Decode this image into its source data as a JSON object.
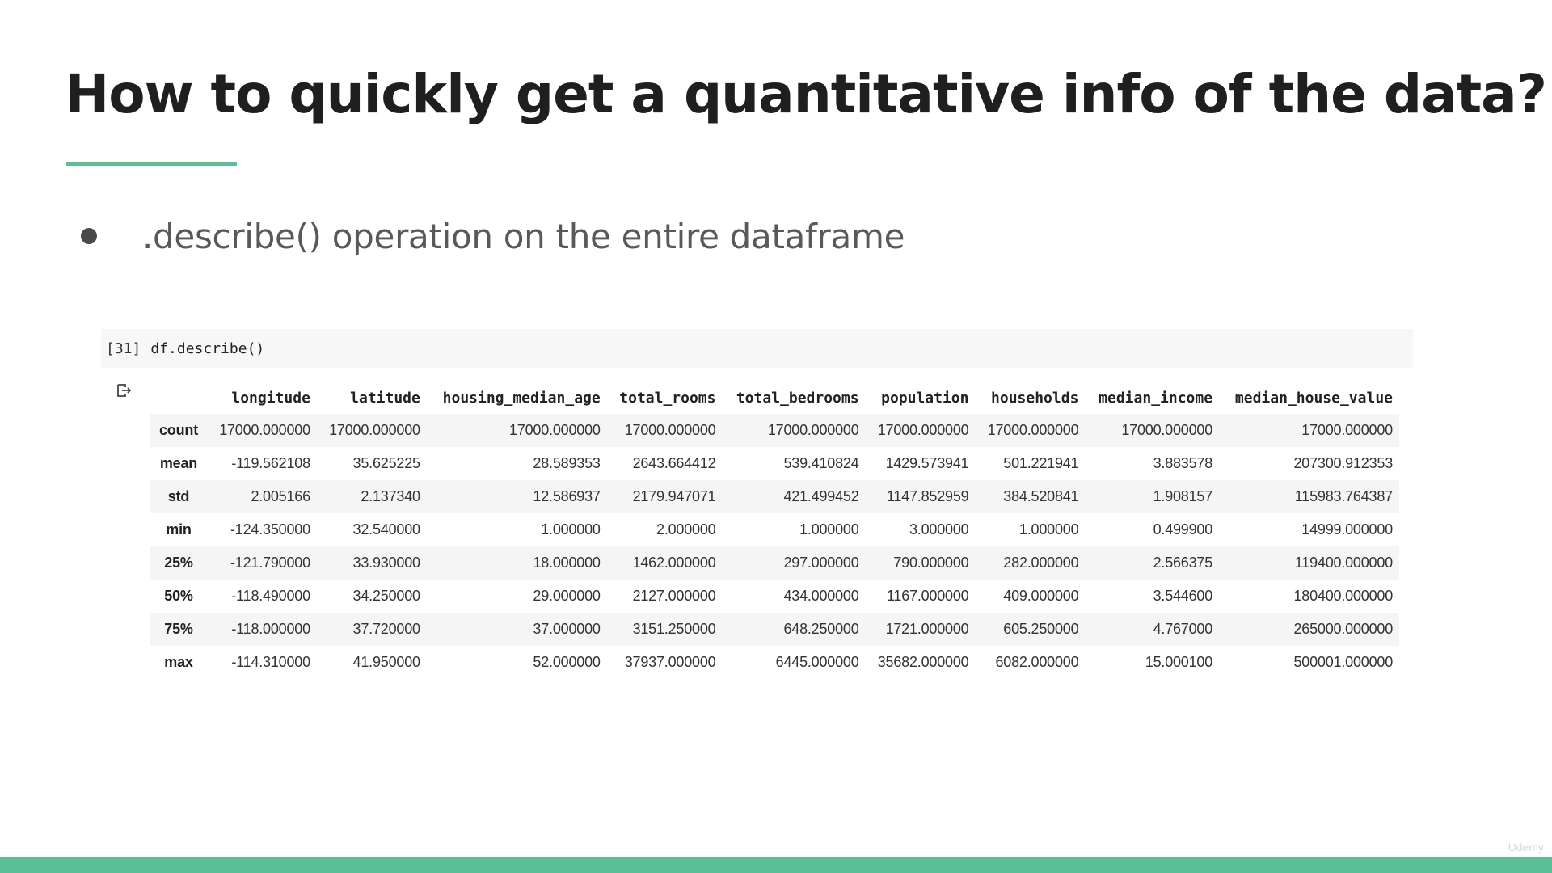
{
  "slide": {
    "title": "How to quickly get a quantitative info of the data?",
    "bullet": ".describe() operation on the entire dataframe",
    "accent_color": "#5bbf95"
  },
  "notebook": {
    "execution_count": "[31]",
    "code": "df.describe()",
    "output_icon": "output-arrow-icon"
  },
  "table": {
    "columns": [
      "longitude",
      "latitude",
      "housing_median_age",
      "total_rooms",
      "total_bedrooms",
      "population",
      "households",
      "median_income",
      "median_house_value"
    ],
    "rows": [
      {
        "label": "count",
        "values": [
          "17000.000000",
          "17000.000000",
          "17000.000000",
          "17000.000000",
          "17000.000000",
          "17000.000000",
          "17000.000000",
          "17000.000000",
          "17000.000000"
        ]
      },
      {
        "label": "mean",
        "values": [
          "-119.562108",
          "35.625225",
          "28.589353",
          "2643.664412",
          "539.410824",
          "1429.573941",
          "501.221941",
          "3.883578",
          "207300.912353"
        ]
      },
      {
        "label": "std",
        "values": [
          "2.005166",
          "2.137340",
          "12.586937",
          "2179.947071",
          "421.499452",
          "1147.852959",
          "384.520841",
          "1.908157",
          "115983.764387"
        ]
      },
      {
        "label": "min",
        "values": [
          "-124.350000",
          "32.540000",
          "1.000000",
          "2.000000",
          "1.000000",
          "3.000000",
          "1.000000",
          "0.499900",
          "14999.000000"
        ]
      },
      {
        "label": "25%",
        "values": [
          "-121.790000",
          "33.930000",
          "18.000000",
          "1462.000000",
          "297.000000",
          "790.000000",
          "282.000000",
          "2.566375",
          "119400.000000"
        ]
      },
      {
        "label": "50%",
        "values": [
          "-118.490000",
          "34.250000",
          "29.000000",
          "2127.000000",
          "434.000000",
          "1167.000000",
          "409.000000",
          "3.544600",
          "180400.000000"
        ]
      },
      {
        "label": "75%",
        "values": [
          "-118.000000",
          "37.720000",
          "37.000000",
          "3151.250000",
          "648.250000",
          "1721.000000",
          "605.250000",
          "4.767000",
          "265000.000000"
        ]
      },
      {
        "label": "max",
        "values": [
          "-114.310000",
          "41.950000",
          "52.000000",
          "37937.000000",
          "6445.000000",
          "35682.000000",
          "6082.000000",
          "15.000100",
          "500001.000000"
        ]
      }
    ]
  },
  "watermark": "Udemy"
}
